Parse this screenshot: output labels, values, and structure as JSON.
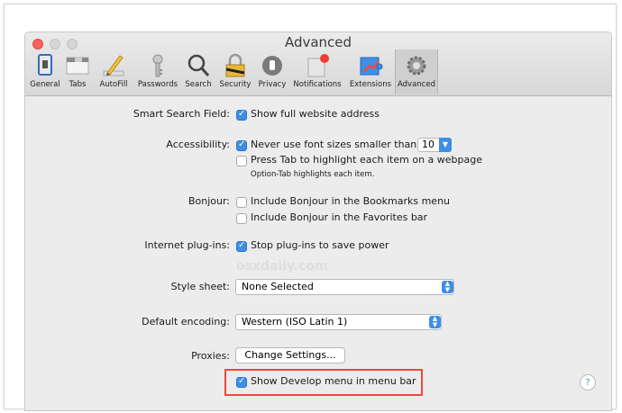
{
  "window": {
    "title": "Advanced"
  },
  "toolbar": {
    "items": [
      {
        "label": "General",
        "icon": "general-switch-icon"
      },
      {
        "label": "Tabs",
        "icon": "tabs-icon"
      },
      {
        "label": "AutoFill",
        "icon": "pencil-icon"
      },
      {
        "label": "Passwords",
        "icon": "key-icon"
      },
      {
        "label": "Search",
        "icon": "magnifier-icon"
      },
      {
        "label": "Security",
        "icon": "padlock-icon"
      },
      {
        "label": "Privacy",
        "icon": "hand-icon"
      },
      {
        "label": "Notifications",
        "icon": "notification-icon"
      },
      {
        "label": "Extensions",
        "icon": "puzzle-icon"
      },
      {
        "label": "Advanced",
        "icon": "gear-icon",
        "selected": true
      }
    ]
  },
  "settings": {
    "smart_search": {
      "label": "Smart Search Field:",
      "option": "Show full website address",
      "checked": true
    },
    "accessibility": {
      "label": "Accessibility:",
      "min_font_option": "Never use font sizes smaller than",
      "min_font_checked": true,
      "min_font_value": "10",
      "tab_option": "Press Tab to highlight each item on a webpage",
      "tab_checked": false,
      "tab_hint": "Option-Tab highlights each item."
    },
    "bonjour": {
      "label": "Bonjour:",
      "bookmarks_option": "Include Bonjour in the Bookmarks menu",
      "favorites_option": "Include Bonjour in the Favorites bar",
      "bookmarks_checked": false,
      "favorites_checked": false
    },
    "plugins": {
      "label": "Internet plug-ins:",
      "option": "Stop plug-ins to save power",
      "checked": true
    },
    "stylesheet": {
      "label": "Style sheet:",
      "value": "None Selected"
    },
    "encoding": {
      "label": "Default encoding:",
      "value": "Western (ISO Latin 1)"
    },
    "proxies": {
      "label": "Proxies:",
      "button": "Change Settings..."
    },
    "develop": {
      "option": "Show Develop menu in menu bar",
      "checked": true
    }
  },
  "watermark": "osxdaily.com",
  "help": "?",
  "colors": {
    "accent": "#3d8ee6",
    "highlight": "#e84b3c"
  }
}
